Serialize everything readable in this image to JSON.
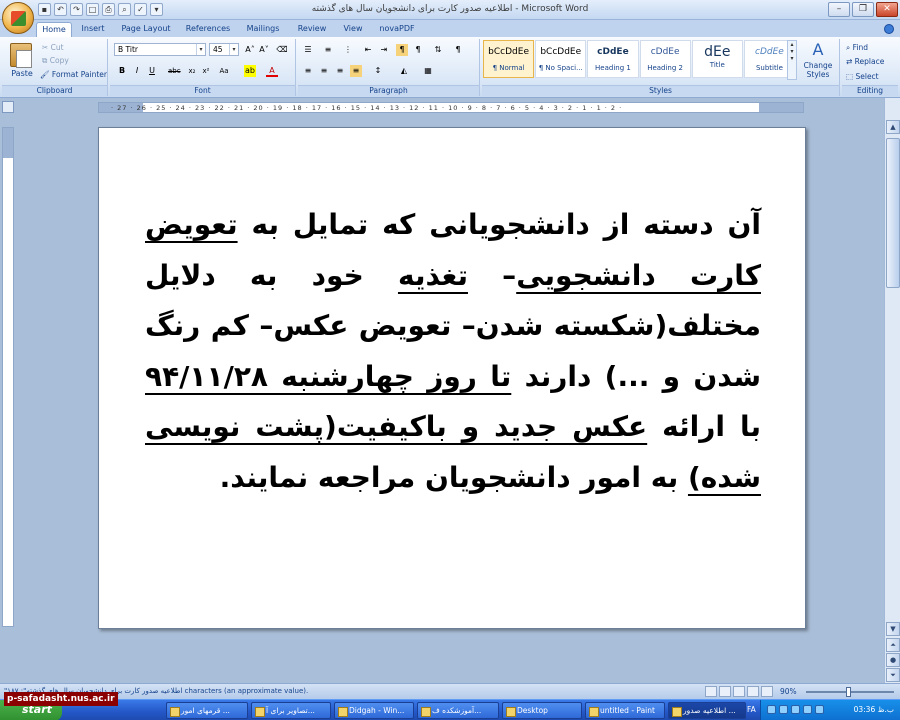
{
  "window": {
    "title": "اطلاعیه صدور کارت برای دانشجویان سال های گذشته - Microsoft Word"
  },
  "tabs": [
    "Home",
    "Insert",
    "Page Layout",
    "References",
    "Mailings",
    "Review",
    "View",
    "novaPDF"
  ],
  "ribbon": {
    "clipboard": {
      "paste": "Paste",
      "cut": "Cut",
      "copy": "Copy",
      "format_painter": "Format Painter",
      "label": "Clipboard"
    },
    "font": {
      "name": "B Titr",
      "size": "45",
      "label": "Font"
    },
    "paragraph": {
      "label": "Paragraph"
    },
    "styles": {
      "label": "Styles",
      "items": [
        {
          "sample": "bCcDdEe",
          "name": "¶ Normal"
        },
        {
          "sample": "bCcDdEe",
          "name": "¶ No Spaci..."
        },
        {
          "sample": "cDdEe",
          "name": "Heading 1"
        },
        {
          "sample": "cDdEe",
          "name": "Heading 2"
        },
        {
          "sample": "dEe",
          "name": "Title"
        },
        {
          "sample": "cDdEe",
          "name": "Subtitle"
        }
      ],
      "change_styles": "Change Styles"
    },
    "editing": {
      "find": "Find",
      "replace": "Replace",
      "select": "Select",
      "label": "Editing"
    }
  },
  "ruler": {
    "marks": "· 27 · 26 · 25 · 24 · 23 · 22 · 21 · 20 · 19 · 18 · 17 · 16 · 15 · 14 · 13 · 12 · 11 · 10 · 9 · 8 · 7 · 6 · 5 · 4 · 3 · 2 · 1 · 1 · 2 ·"
  },
  "document": {
    "segments": [
      {
        "text": "آن دسته از دانشجویانی که تمایل به ",
        "u": false
      },
      {
        "text": "تعویض کارت دانشجویی",
        "u": true
      },
      {
        "text": "– ",
        "u": false
      },
      {
        "text": "تغذیه",
        "u": true
      },
      {
        "text": " خود به دلایل مختلف(شکسته شدن– تعویض عکس– کم رنگ شدن و ...) دارند ",
        "u": false
      },
      {
        "text": "تا روز چهارشنبه ۹۴/۱۱/۲۸",
        "u": true
      },
      {
        "text": " با ارائه ",
        "u": false
      },
      {
        "text": "عکس جدید و باکیفیت(پشت نویسی شده)",
        "u": true
      },
      {
        "text": " به امور دانشجویان مراجعه نمایند.",
        "u": false
      }
    ]
  },
  "statusbar": {
    "text": "\"اطلاعیه صدور کارت برای دانشجویان سال های گذشته\": ۱۸۷ characters (an approximate value).",
    "zoom": "90%"
  },
  "taskbar": {
    "start": "start",
    "watermark": "p-safadasht.nus.ac.ir",
    "buttons": [
      "قرمهای امور ...",
      "تصاویر برای آ...",
      "Didgah - Win...",
      "آموزشکده ف...",
      "Desktop",
      "untitled - Paint",
      "اطلاعیه صدور ..."
    ],
    "lang": "FA",
    "clock": "03:36 ب.ظ"
  }
}
